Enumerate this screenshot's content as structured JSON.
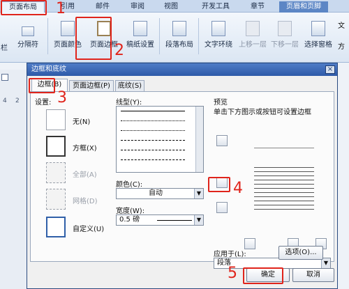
{
  "ribbon": {
    "tabs": [
      "页面布局",
      "引用",
      "邮件",
      "审阅",
      "视图",
      "开发工具",
      "章节",
      "页眉和页脚"
    ],
    "right_fragments": [
      "文",
      "方"
    ],
    "buttons": {
      "columns": "栏",
      "breaks": "分隔符",
      "page_color": "页面颜色",
      "page_border": "页面边框",
      "paper_setup": "稿纸设置",
      "para_layout": "段落布局",
      "text_wrap": "文字环绕",
      "bring_forward": "上移一层",
      "send_backward": "下移一层",
      "select_pane": "选择窗格"
    }
  },
  "ruler": {
    "numbers": [
      "4",
      "2"
    ]
  },
  "annotations": [
    "1",
    "2",
    "3",
    "4",
    "5"
  ],
  "dialog": {
    "title": "边框和底纹",
    "close": "×",
    "tabs": [
      "边框(B)",
      "页面边框(P)",
      "底纹(S)"
    ],
    "setting_label": "设置:",
    "settings": [
      "无(N)",
      "方框(X)",
      "全部(A)",
      "网格(D)",
      "自定义(U)"
    ],
    "style_label": "线型(Y):",
    "color_label": "颜色(C):",
    "color_value": "自动",
    "width_label": "宽度(W):",
    "width_value": "0.5  磅",
    "preview_label": "预览",
    "preview_hint": "单击下方图示或按钮可设置边框",
    "apply_label": "应用于(L):",
    "apply_value": "段落",
    "options_button": "选项(O)...",
    "ok": "确定",
    "cancel": "取消"
  },
  "colors": {
    "annotation": "#e0241b",
    "titlebar": "#2e5aa8",
    "context_tab": "#5c86c5"
  }
}
